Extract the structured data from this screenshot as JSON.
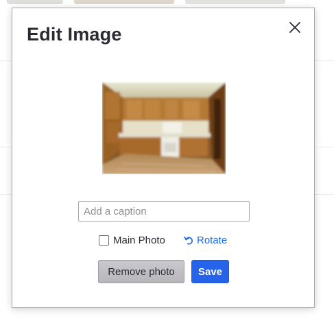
{
  "modal": {
    "title": "Edit Image",
    "close_icon": "close-icon",
    "photo_alt": "kitchen photo",
    "caption": {
      "value": "",
      "placeholder": "Add a caption"
    },
    "main_photo": {
      "label": "Main Photo",
      "checked": false
    },
    "rotate": {
      "label": "Rotate",
      "icon": "rotate-left-icon"
    },
    "remove_button_label": "Remove photo",
    "save_button_label": "Save"
  },
  "colors": {
    "accent": "#2563eb",
    "link": "#1a6be8",
    "title_text": "#2a2a33",
    "secondary_button": "#bdbdc1"
  }
}
